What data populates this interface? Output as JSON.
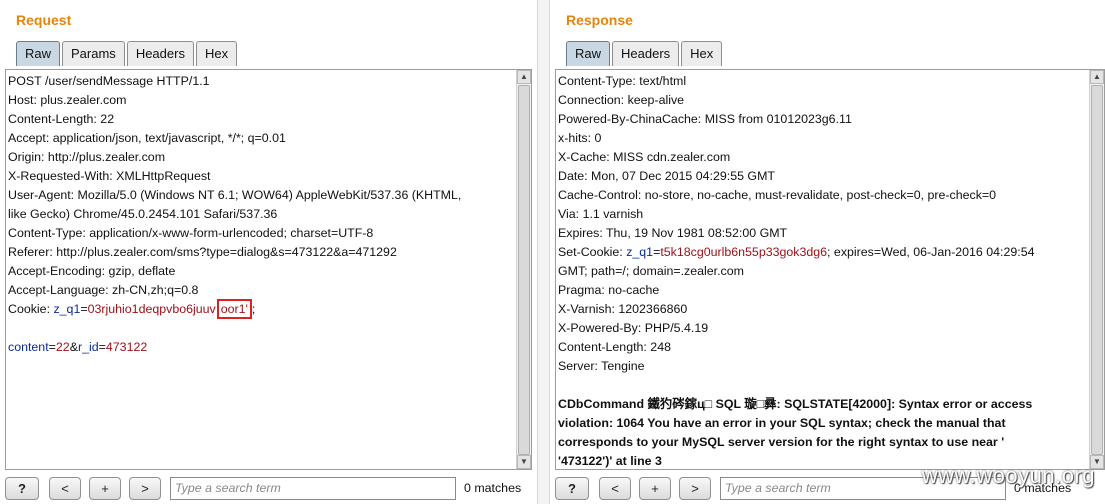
{
  "request": {
    "title": "Request",
    "tabs": [
      "Raw",
      "Params",
      "Headers",
      "Hex"
    ],
    "lines": [
      "POST /user/sendMessage HTTP/1.1",
      "Host: plus.zealer.com",
      "Content-Length: 22",
      "Accept: application/json, text/javascript, */*; q=0.01",
      "Origin: http://plus.zealer.com",
      "X-Requested-With: XMLHttpRequest",
      "User-Agent: Mozilla/5.0 (Windows NT 6.1; WOW64) AppleWebKit/537.36 (KHTML,",
      "like Gecko) Chrome/45.0.2454.101 Safari/537.36",
      "Content-Type: application/x-www-form-urlencoded; charset=UTF-8",
      "Referer: http://plus.zealer.com/sms?type=dialog&s=473122&a=471292",
      "Accept-Encoding: gzip, deflate",
      "Accept-Language: zh-CN,zh;q=0.8"
    ],
    "cookie": {
      "prefix": "Cookie: ",
      "name": "z_q1",
      "eq": "=",
      "value": "03rjuhio1deqpvbo6juuv",
      "highlighted": "oor1'",
      "suffix": ";"
    },
    "body": {
      "k1": "content",
      "eq1": "=",
      "v1": "22",
      "amp": "&",
      "k2": "r_id",
      "eq2": "=",
      "v2": "473122"
    },
    "search": {
      "placeholder": "Type a search term",
      "matches": "0 matches"
    },
    "buttons": {
      "help": "?",
      "prev": "<",
      "add": "+",
      "next": ">"
    }
  },
  "response": {
    "title": "Response",
    "tabs": [
      "Raw",
      "Headers",
      "Hex"
    ],
    "lines_top": [
      "Content-Type: text/html",
      "Connection: keep-alive",
      "Powered-By-ChinaCache: MISS from 01012023g6.11",
      "x-hits: 0",
      "X-Cache: MISS cdn.zealer.com",
      "Date: Mon, 07 Dec 2015 04:29:55 GMT",
      "Cache-Control: no-store, no-cache, must-revalidate, post-check=0, pre-check=0",
      "Via: 1.1 varnish",
      "Expires: Thu, 19 Nov 1981 08:52:00 GMT"
    ],
    "set_cookie": {
      "prefix": "Set-Cookie: ",
      "name": "z_q1",
      "eq": "=",
      "value": "t5k18cg0urlb6n55p33gok3dg6",
      "rest": "; expires=Wed, 06-Jan-2016 04:29:54",
      "cont": "GMT; path=/; domain=.zealer.com"
    },
    "lines_bottom": [
      "Pragma: no-cache",
      "X-Varnish: 1202366860",
      "X-Powered-By: PHP/5.4.19",
      "Content-Length: 248",
      "Server: Tengine"
    ],
    "error_lines": [
      "CDbCommand 鐵犳硶鎵ц□ SQL 璇□彞: SQLSTATE[42000]: Syntax error or access",
      "violation: 1064 You have an error in your SQL syntax; check the manual that",
      "corresponds to your MySQL server version for the right syntax to use near '",
      "'473122')' at line 3"
    ],
    "search": {
      "placeholder": "Type a search term",
      "matches": "0 matches"
    },
    "buttons": {
      "help": "?",
      "prev": "<",
      "add": "+",
      "next": ">"
    }
  },
  "watermark": "www.wooyun.org"
}
